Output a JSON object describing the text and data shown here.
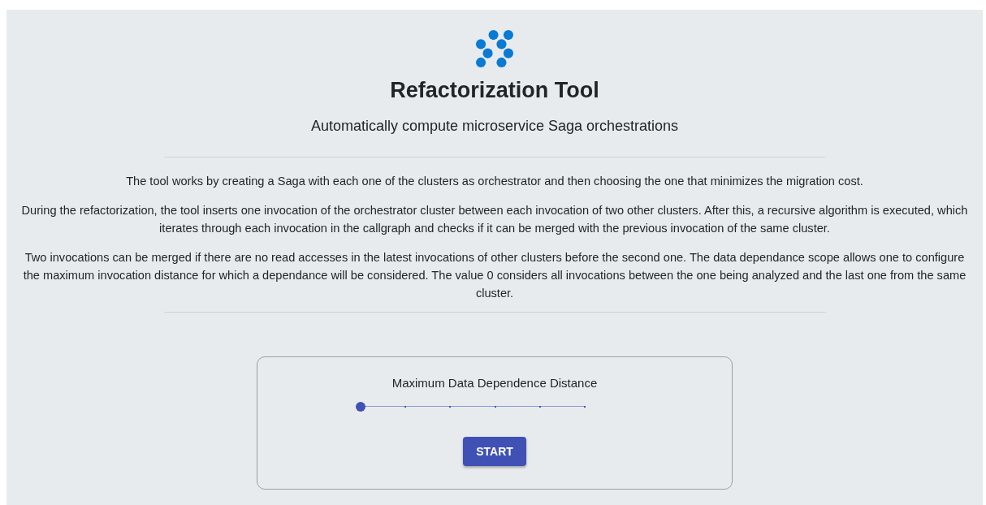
{
  "title": "Refactorization Tool",
  "subtitle": "Automatically compute microservice Saga orchestrations",
  "paragraphs": [
    "The tool works by creating a Saga with each one of the clusters as orchestrator and then choosing the one that minimizes the migration cost.",
    "During the refactorization, the tool inserts one invocation of the orchestrator cluster between each invocation of two other clusters. After this, a recursive algorithm is executed, which iterates through each invocation in the callgraph and checks if it can be merged with the previous invocation of the same cluster.",
    "Two invocations can be merged if there are no read accesses in the latest invocations of other clusters before the second one. The data dependance scope allows one to configure the maximum invocation distance for which a dependance will be considered. The value 0 considers all invocations between the one being analyzed and the last one from the same cluster."
  ],
  "slider": {
    "label": "Maximum Data Dependence Distance",
    "level": 0
  },
  "button": "START"
}
